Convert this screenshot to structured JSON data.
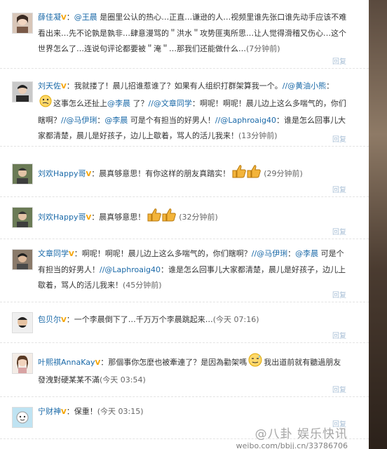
{
  "comments": [
    {
      "user": "薛佳凝",
      "parts": [
        "：",
        "@王晨",
        " 是圈里公认的热心…正直…谦逊的人…视频里谁先张口谁先动手应该不难看出来…先不论孰是孰非…肆意漫骂的＂洪水＂攻势匪夷所思…让人觉得滑稽又伤心…这个世界怎么了…连说句评论都要被＂淹＂…那我们还能做什么…"
      ],
      "time": "(7分钟前)",
      "reply": "回复"
    },
    {
      "user": "刘天佐",
      "parts": [
        "：我就搂了！晨儿招谁惹谁了？如果有人组织打群架算我一个。",
        "//@黄油小熊",
        "：",
        "这事怎么还扯上",
        "@李晨",
        " 了？",
        "//@文章同学",
        "：啊呢！啊呢！晨儿边上这么多喘气的，你们瞎啊？",
        "//@马伊琍",
        "：",
        "@李晨",
        " 可是个有担当的好男人！",
        "//@Laphroaig40",
        "：谁是怎么回事儿大家都清楚，晨儿是好孩子，边儿上歇着，骂人的活儿我来！"
      ],
      "time": "(13分钟前)",
      "reply": "回复"
    },
    {
      "user": "刘欢Happy哥",
      "parts": [
        "：晨真够意思！有你这样的朋友真踏实！"
      ],
      "time": "(29分钟前)",
      "reply": "回复"
    },
    {
      "user": "刘欢Happy哥",
      "parts": [
        "：晨真够意思！"
      ],
      "time": "(32分钟前)",
      "reply": "回复"
    },
    {
      "user": "文章同学",
      "parts": [
        "：啊呢！啊呢！晨儿边上这么多喘气的，你们瞎啊？",
        "//@马伊琍",
        "：",
        "@李晨",
        " 可是个有担当的好男人！",
        "//@Laphroaig40",
        "：谁是怎么回事儿大家都清楚，晨儿是好孩子，边儿上歇着，骂人的活儿我来！"
      ],
      "time": "(45分钟前)",
      "reply": "回复"
    },
    {
      "user": "包贝尔",
      "parts": [
        "：一个李晨倒下了…千万万个李晨跳起来…"
      ],
      "time": "(今天 07:16)",
      "reply": "回复"
    },
    {
      "user": "叶熙祺AnnaKay",
      "parts": [
        "：那個事你怎麼也被牽連了？是因為勸架嗎",
        "我出道前就有聽過朋友發洩對硬某某不滿"
      ],
      "time": "(今天 03:54)",
      "reply": "回复"
    },
    {
      "user": "宁财神",
      "parts": [
        "：保重！"
      ],
      "time": "(今天 03:15)",
      "reply": "回复"
    }
  ],
  "watermark": {
    "top": "@八卦 娱乐快讯",
    "url": "weibo.com/bbjj.cn/33786706"
  },
  "colors": {
    "link": "#1a69a8",
    "vbadge": "#f5a300",
    "reply": "#a8bfd6"
  }
}
